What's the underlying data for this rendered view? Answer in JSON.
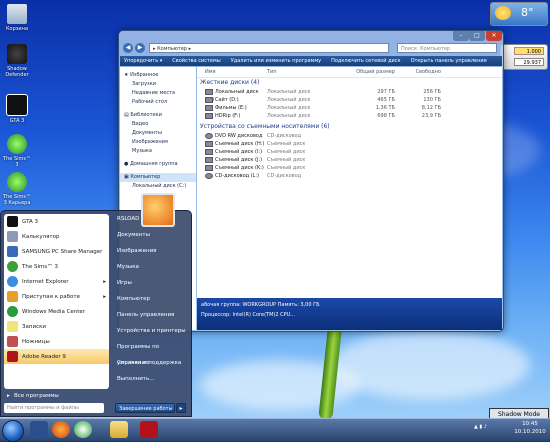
{
  "desktop_icons": [
    {
      "label": "Корзина"
    },
    {
      "label": "Shadow Defender"
    },
    {
      "label": "GTA 3"
    },
    {
      "label": "The Sims™ 3"
    },
    {
      "label": "The Sims™ 3 Карьера"
    }
  ],
  "gadgets": {
    "weather_temp": "8°",
    "currency_1": "1.000",
    "currency_2": "29.937"
  },
  "explorer": {
    "address": "▸ Компьютер ▸",
    "search_placeholder": "Поиск: Компьютер",
    "toolbar": [
      "Упорядочить ▾",
      "Свойства системы",
      "Удалить или изменить программу",
      "Подключить сетевой диск",
      "Открыть панель управления"
    ],
    "nav": {
      "favorites_header": "Избранное",
      "favorites": [
        "Загрузки",
        "Недавние места",
        "Рабочий стол"
      ],
      "libraries_header": "Библиотеки",
      "libraries": [
        "Видео",
        "Документы",
        "Изображения",
        "Музыка"
      ],
      "homegroup": "Домашняя группа",
      "computer": "Компьютер",
      "computer_child": "Локальный диск (C:)"
    },
    "columns": [
      "Имя",
      "Тип",
      "Общий размер",
      "Свободно"
    ],
    "hard_group": "Жесткие диски (4)",
    "hard_disks": [
      {
        "name": "Локальный диск (C:)",
        "type": "Локальный диск",
        "total": "297 ГБ",
        "free": "256 ГБ"
      },
      {
        "name": "Сайт (D:)",
        "type": "Локальный диск",
        "total": "465 ГБ",
        "free": "130 ГБ"
      },
      {
        "name": "Фильмы (E:)",
        "type": "Локальный диск",
        "total": "1,36 ТБ",
        "free": "8,12 ГБ"
      },
      {
        "name": "HDRip (F:)",
        "type": "Локальный диск",
        "total": "698 ГБ",
        "free": "23,9 ГБ"
      }
    ],
    "removable_group": "Устройства со съемными носителями (6)",
    "removable": [
      {
        "name": "DVD RW дисковод (...",
        "type": "CD-дисковод"
      },
      {
        "name": "Съемный диск (H:)",
        "type": "Съемный диск"
      },
      {
        "name": "Съемный диск (I:)",
        "type": "Съемный диск"
      },
      {
        "name": "Съемный диск (J:)",
        "type": "Съемный диск"
      },
      {
        "name": "Съемный диск (K:)",
        "type": "Съемный диск"
      },
      {
        "name": "CD-дисковод (L:)",
        "type": "CD-дисковод"
      }
    ],
    "details_line1": "абочая группа: WORKGROUP     Память: 3,00 ГБ",
    "details_line2": "Процессор: Intel(R) Core(TM)2 CPU..."
  },
  "start_menu": {
    "programs": [
      "GTA 3",
      "Калькулятор",
      "SAMSUNG PC Share Manager",
      "The Sims™ 3",
      "Internet Explorer",
      "Приступая к работе",
      "Windows Media Center",
      "Записки",
      "Ножницы",
      "Adobe Reader 9"
    ],
    "all_programs": "Все программы",
    "search_placeholder": "Найти программы и файлы",
    "right": [
      "RSLOAD",
      "Документы",
      "Изображения",
      "Музыка",
      "Игры",
      "Компьютер",
      "Панель управления",
      "Устройства и принтеры",
      "Программы по умолчанию",
      "Справка и поддержка",
      "Выполнить..."
    ],
    "shutdown": "Завершение работы"
  },
  "taskbar": {
    "time": "10:45",
    "date": "10.10.2010",
    "shadow_mode": "Shadow Mode"
  }
}
